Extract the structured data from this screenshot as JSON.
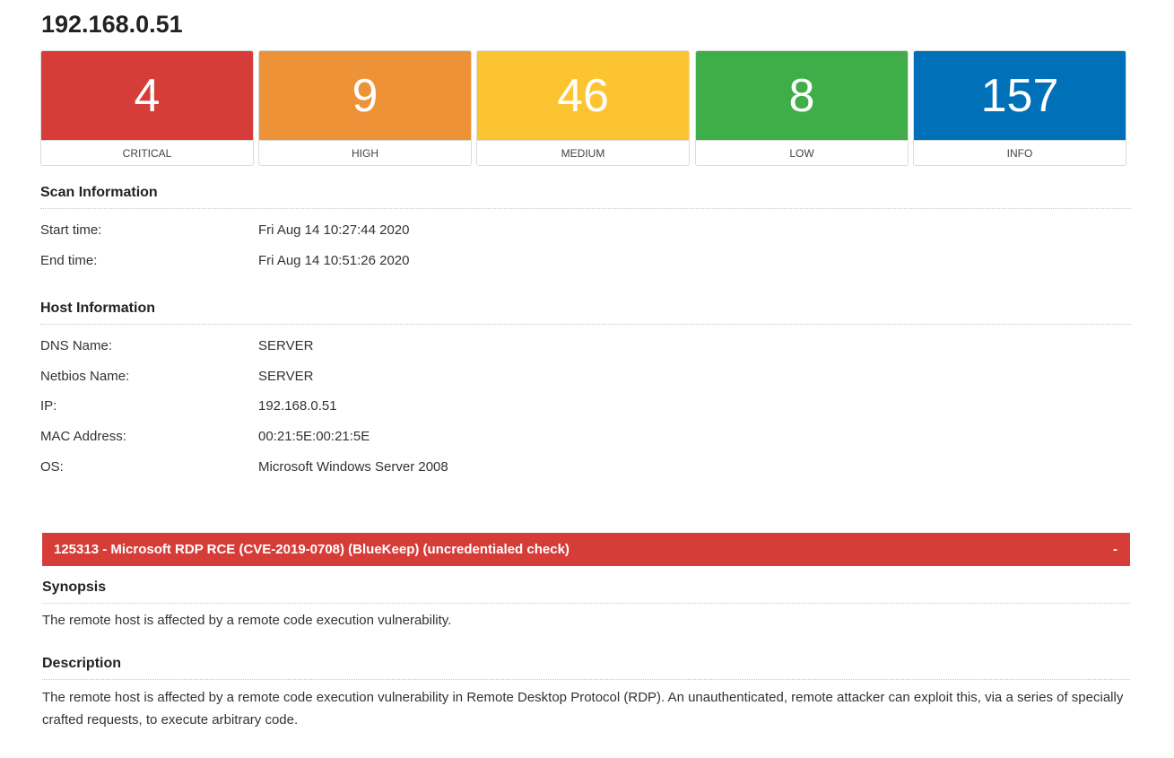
{
  "host": {
    "title": "192.168.0.51"
  },
  "severity": [
    {
      "count": "4",
      "label": "CRITICAL",
      "color": "#d63d39"
    },
    {
      "count": "9",
      "label": "HIGH",
      "color": "#ed9236"
    },
    {
      "count": "46",
      "label": "MEDIUM",
      "color": "#fdc431"
    },
    {
      "count": "8",
      "label": "LOW",
      "color": "#3fae49"
    },
    {
      "count": "157",
      "label": "INFO",
      "color": "#0071b9"
    }
  ],
  "scan_info": {
    "heading": "Scan Information",
    "rows": [
      {
        "label": "Start time:",
        "value": "Fri Aug 14 10:27:44 2020"
      },
      {
        "label": "End time:",
        "value": "Fri Aug 14 10:51:26 2020"
      }
    ]
  },
  "host_info": {
    "heading": "Host Information",
    "rows": [
      {
        "label": "DNS Name:",
        "value": "SERVER"
      },
      {
        "label": "Netbios Name:",
        "value": "SERVER"
      },
      {
        "label": "IP:",
        "value": "192.168.0.51"
      },
      {
        "label": "MAC Address:",
        "value": "00:21:5E:00:21:5E"
      },
      {
        "label": "OS:",
        "value": "Microsoft Windows Server 2008"
      }
    ]
  },
  "vulnerability": {
    "title": "125313 - Microsoft RDP RCE (CVE-2019-0708) (BlueKeep) (uncredentialed check)",
    "toggle": "-",
    "color": "#d63d39",
    "synopsis_heading": "Synopsis",
    "synopsis": "The remote host is affected by a remote code execution vulnerability.",
    "description_heading": "Description",
    "description": "The remote host is affected by a remote code execution vulnerability in Remote Desktop Protocol (RDP). An unauthenticated, remote attacker can exploit this, via a series of specially crafted requests, to execute arbitrary code."
  }
}
